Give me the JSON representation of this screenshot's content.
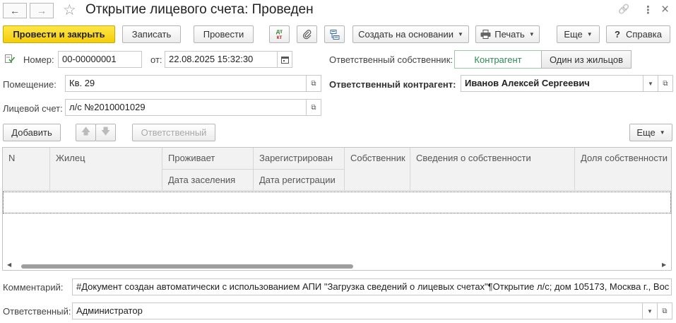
{
  "window": {
    "title": "Открытие лицевого счета: Проведен",
    "back_icon": "←",
    "forward_icon": "→",
    "favorite_icon": "☆",
    "link_icon": "🔗",
    "more_icon": "⋮",
    "close_icon": "×"
  },
  "toolbar": {
    "post_close": "Провести и закрыть",
    "save": "Записать",
    "post": "Провести",
    "dtkt_top": "дт",
    "dtkt_bottom": "кт",
    "create_based_on": "Создать на основании",
    "print": "Печать",
    "more": "Еще",
    "help": "Справка",
    "help_icon": "?"
  },
  "form": {
    "number_label": "Номер:",
    "number_value": "00-00000001",
    "date_label": "от:",
    "date_value": "22.08.2025 15:32:30",
    "premises_label": "Помещение:",
    "premises_value": "Кв. 29",
    "account_label": "Лицевой счет:",
    "account_value": "л/с №2010001029",
    "owner_label": "Ответственный собственник:",
    "owner_options": [
      "Контрагент",
      "Один из жильцов"
    ],
    "contractor_label": "Ответственный контрагент:",
    "contractor_value": "Иванов Алексей Сергеевич"
  },
  "table_toolbar": {
    "add": "Добавить",
    "responsible": "Ответственный",
    "more": "Еще"
  },
  "table": {
    "col_n": "N",
    "col_resident": "Жилец",
    "col_lives": "Проживает",
    "col_move_in": "Дата заселения",
    "col_registered": "Зарегистрирован",
    "col_reg_date": "Дата регистрации",
    "col_owner": "Собственник",
    "col_ownership_info": "Сведения о собственности",
    "col_ownership_share": "Доля собственности"
  },
  "footer": {
    "comment_label": "Комментарий:",
    "comment_value": "#Документ создан автоматически с использованием АПИ \"Загрузка сведений о лицевых счетах\"¶Открытие л/с; дом 105173, Москва г., Вос",
    "responsible_label": "Ответственный:",
    "responsible_value": "Администратор"
  },
  "colors": {
    "primary_button": "#f5cd07",
    "selected_segment_text": "#2e8b57"
  }
}
